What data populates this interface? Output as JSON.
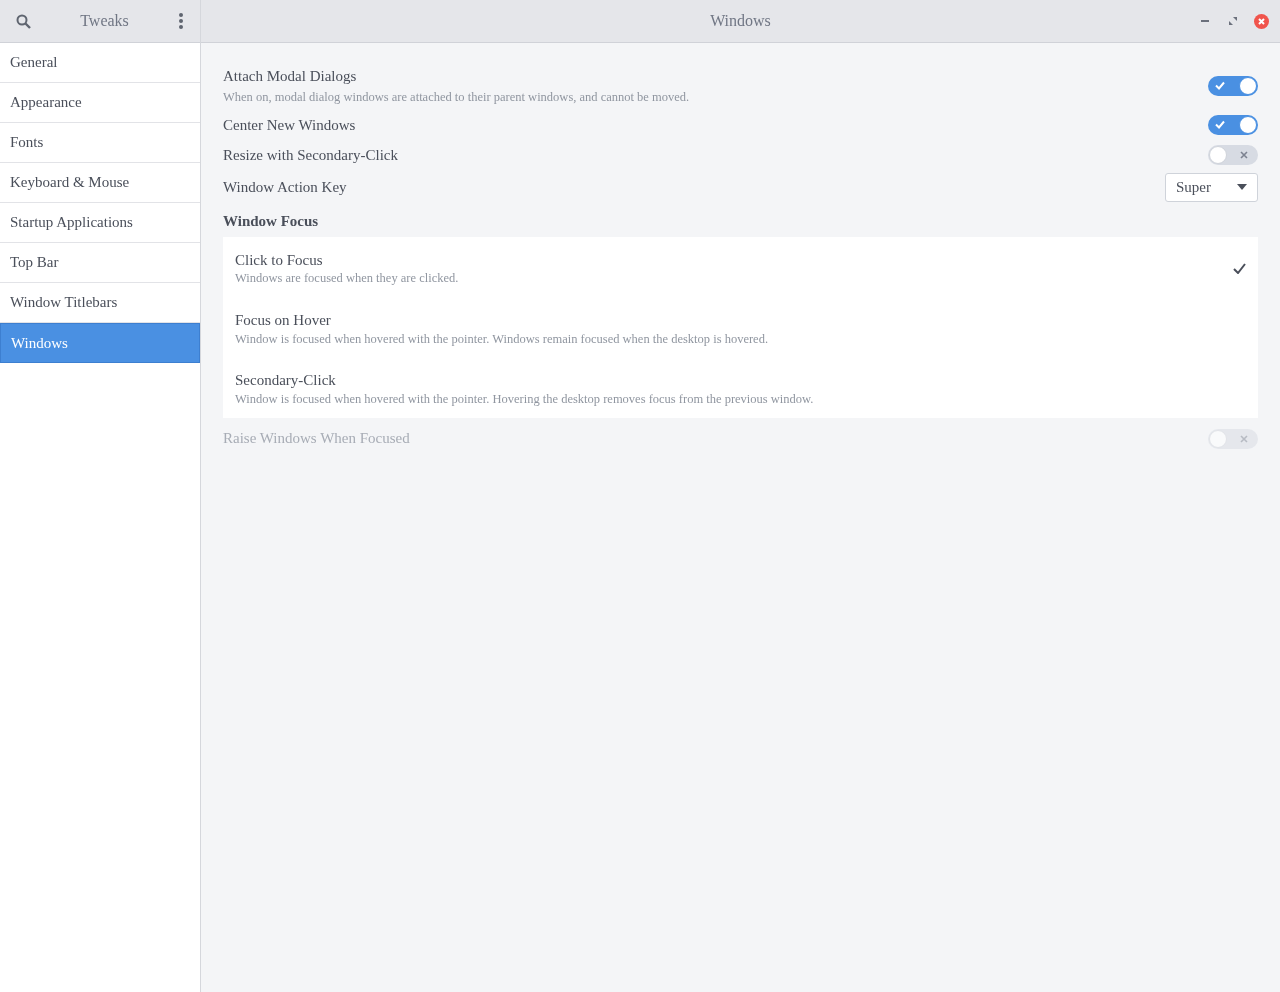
{
  "sidebar_header": {
    "title": "Tweaks"
  },
  "window": {
    "title": "Windows"
  },
  "sidebar": {
    "items": [
      {
        "label": "General",
        "selected": false
      },
      {
        "label": "Appearance",
        "selected": false
      },
      {
        "label": "Fonts",
        "selected": false
      },
      {
        "label": "Keyboard & Mouse",
        "selected": false
      },
      {
        "label": "Startup Applications",
        "selected": false
      },
      {
        "label": "Top Bar",
        "selected": false
      },
      {
        "label": "Window Titlebars",
        "selected": false
      },
      {
        "label": "Windows",
        "selected": true
      }
    ]
  },
  "settings": [
    {
      "kind": "switch",
      "label": "Attach Modal Dialogs",
      "description": "When on, modal dialog windows are attached to their parent windows, and cannot be moved.",
      "on": true,
      "disabled": false
    },
    {
      "kind": "switch",
      "label": "Center New Windows",
      "on": true,
      "disabled": false
    },
    {
      "kind": "switch",
      "label": "Resize with Secondary-Click",
      "on": false,
      "disabled": false
    },
    {
      "kind": "dropdown",
      "label": "Window Action Key",
      "value": "Super"
    },
    {
      "kind": "heading",
      "label": "Window Focus"
    },
    {
      "kind": "choices",
      "options": [
        {
          "label": "Click to Focus",
          "description": "Windows are focused when they are clicked.",
          "selected": true
        },
        {
          "label": "Focus on Hover",
          "description": "Window is focused when hovered with the pointer. Windows remain focused when the desktop is hovered.",
          "selected": false
        },
        {
          "label": "Secondary-Click",
          "description": "Window is focused when hovered with the pointer. Hovering the desktop removes focus from the previous window.",
          "selected": false
        }
      ]
    },
    {
      "kind": "switch",
      "label": "Raise Windows When Focused",
      "on": false,
      "disabled": true
    }
  ]
}
